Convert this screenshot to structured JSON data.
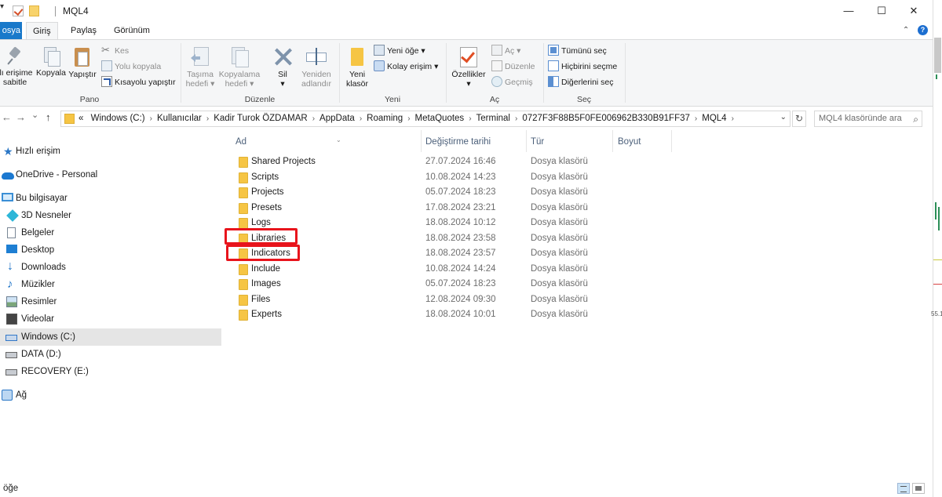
{
  "window": {
    "title": "MQL4",
    "quick_access_arrow": "▾",
    "minimize_glyph": "—",
    "maximize_glyph": "☐",
    "close_glyph": "✕"
  },
  "ribbon_tabs": {
    "file": "osya",
    "home": "Giriş",
    "share": "Paylaş",
    "view": "Görünüm",
    "expand_glyph": "⌃",
    "help_glyph": "?"
  },
  "ribbon": {
    "clipboard": {
      "label": "Pano",
      "pin_line1": "ılı erişime",
      "pin_line2": "sabitle",
      "copy": "Kopyala",
      "paste": "Yapıştır",
      "cut": "Kes",
      "copy_path": "Yolu kopyala",
      "paste_shortcut": "Kısayolu yapıştır"
    },
    "organize": {
      "label": "Düzenle",
      "move_line1": "Taşıma",
      "move_line2": "hedefi ▾",
      "copyto_line1": "Kopyalama",
      "copyto_line2": "hedefi ▾",
      "delete_line1": "Sil",
      "delete_line2": "▾",
      "rename_line1": "Yeniden",
      "rename_line2": "adlandır"
    },
    "new": {
      "label": "Yeni",
      "folder_line1": "Yeni",
      "folder_line2": "klasör",
      "new_item": "Yeni öğe ▾",
      "easy_access": "Kolay erişim ▾"
    },
    "open": {
      "label": "Aç",
      "properties_line1": "Özellikler",
      "properties_line2": "▾",
      "open": "Aç ▾",
      "edit": "Düzenle",
      "history": "Geçmiş"
    },
    "select": {
      "label": "Seç",
      "select_all": "Tümünü seç",
      "select_none": "Hiçbirini seçme",
      "invert": "Diğerlerini seç"
    }
  },
  "navigation": {
    "back_glyph": "←",
    "forward_glyph": "→",
    "recent_glyph": "⌄",
    "up_glyph": "↑",
    "address_prefix": "«",
    "breadcrumbs": [
      "Windows (C:)",
      "Kullanıcılar",
      "Kadir Turok ÖZDAMAR",
      "AppData",
      "Roaming",
      "MetaQuotes",
      "Terminal",
      "0727F3F88B5F0FE006962B330B91FF37",
      "MQL4"
    ],
    "crumb_sep": "›",
    "address_dropdown": "⌄",
    "refresh_glyph": "↻",
    "search_placeholder": "MQL4 klasöründe ara",
    "search_glyph": "⌕"
  },
  "sidebar": {
    "items": [
      {
        "label": "Hızlı erişim"
      },
      {
        "label": "OneDrive - Personal"
      },
      {
        "label": "Bu bilgisayar"
      },
      {
        "label": "3D Nesneler"
      },
      {
        "label": "Belgeler"
      },
      {
        "label": "Desktop"
      },
      {
        "label": "Downloads"
      },
      {
        "label": "Müzikler"
      },
      {
        "label": "Resimler"
      },
      {
        "label": "Videolar"
      },
      {
        "label": "Windows (C:)"
      },
      {
        "label": "DATA (D:)"
      },
      {
        "label": "RECOVERY (E:)"
      },
      {
        "label": "Ağ"
      }
    ]
  },
  "file_list": {
    "columns": {
      "name": "Ad",
      "date": "Değiştirme tarihi",
      "type": "Tür",
      "size": "Boyut"
    },
    "sort_glyph": "⌄",
    "rows": [
      {
        "name": "Shared Projects",
        "date": "27.07.2024 16:46",
        "type": "Dosya klasörü"
      },
      {
        "name": "Scripts",
        "date": "10.08.2024 14:23",
        "type": "Dosya klasörü"
      },
      {
        "name": "Projects",
        "date": "05.07.2024 18:23",
        "type": "Dosya klasörü"
      },
      {
        "name": "Presets",
        "date": "17.08.2024 23:21",
        "type": "Dosya klasörü"
      },
      {
        "name": "Logs",
        "date": "18.08.2024 10:12",
        "type": "Dosya klasörü"
      },
      {
        "name": "Libraries",
        "date": "18.08.2024 23:58",
        "type": "Dosya klasörü"
      },
      {
        "name": "Indicators",
        "date": "18.08.2024 23:57",
        "type": "Dosya klasörü"
      },
      {
        "name": "Include",
        "date": "10.08.2024 14:24",
        "type": "Dosya klasörü"
      },
      {
        "name": "Images",
        "date": "05.07.2024 18:23",
        "type": "Dosya klasörü"
      },
      {
        "name": "Files",
        "date": "12.08.2024 09:30",
        "type": "Dosya klasörü"
      },
      {
        "name": "Experts",
        "date": "18.08.2024 10:01",
        "type": "Dosya klasörü"
      }
    ],
    "highlight_color": "#e8141c"
  },
  "background_app": {
    "value_label": "55.1"
  },
  "status_bar": {
    "item_count": "öğe"
  },
  "colors": {
    "accent": "#1979ca",
    "folder": "#f6c544",
    "selection": "#e5e5e5"
  }
}
